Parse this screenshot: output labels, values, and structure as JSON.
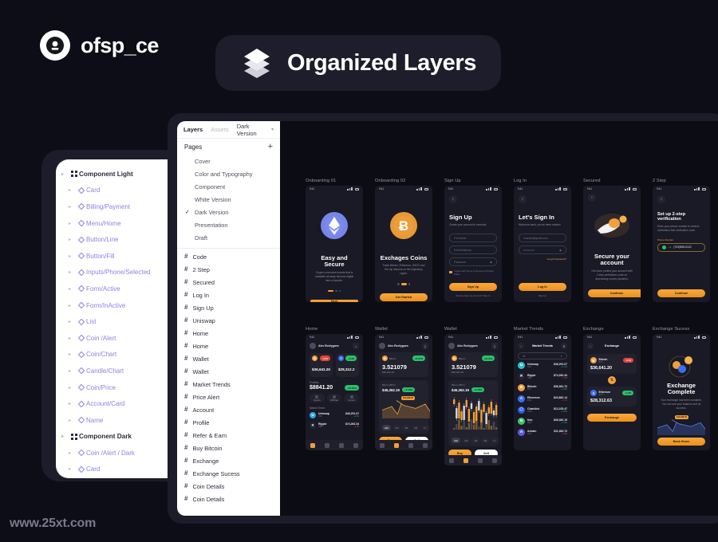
{
  "brand": {
    "name": "ofsp_ce",
    "logo_icon": "circle-avatar-icon"
  },
  "title_badge": {
    "text": "Organized Layers",
    "icon": "layers-icon"
  },
  "watermark": {
    "text": "www.25xt.com"
  },
  "colors": {
    "accent": "#F2A03A",
    "panel_dark": "#191a26",
    "page_bg": "#0d0d18",
    "green": "#2bbf6b",
    "red": "#e2453c",
    "purple_layer": "#8b84e0"
  },
  "light_panel": {
    "groups": [
      {
        "label": "Component Light",
        "icon": "component-icon",
        "items": [
          "Card",
          "Billing/Payment",
          "Menu/Home",
          "Button/Line",
          "Button/Fill",
          "Inputs/Phone/Selected",
          "Form/Active",
          "Form/InActive",
          "List",
          "Coin /Alert",
          "Coin/Chart",
          "Candle/Chart",
          "Coin/Price",
          "Account/Card",
          "Name"
        ]
      },
      {
        "label": "Component Dark",
        "icon": "component-icon",
        "items": [
          "Coin /Alert / Dark",
          "Card",
          "Card"
        ]
      }
    ]
  },
  "figma": {
    "tabs": [
      {
        "label": "Layers",
        "active": true
      },
      {
        "label": "Assets",
        "active": false
      }
    ],
    "version_selector": {
      "label": "Dark Version",
      "chevron": "chevron-down-icon"
    },
    "pages_header": {
      "label": "Pages",
      "add_icon": "plus-icon"
    },
    "pages": [
      {
        "name": "Cover",
        "selected": false
      },
      {
        "name": "Color and Typography",
        "selected": false
      },
      {
        "name": "Component",
        "selected": false
      },
      {
        "name": "White Version",
        "selected": false
      },
      {
        "name": "Dark Version",
        "selected": true
      },
      {
        "name": "Presentation",
        "selected": false
      },
      {
        "name": "Draft",
        "selected": false
      }
    ],
    "layers": [
      "Code",
      "2 Step",
      "Secured",
      "Log In",
      "Sign Up",
      "Uniswap",
      "Home",
      "Home",
      "Wallet",
      "Wallet",
      "Market Trends",
      "Price Alert",
      "Account",
      "Profile",
      "Refer & Earn",
      "Buy Bitcoin",
      "Exchange",
      "Exchange Sucess",
      "Coin Details",
      "Coin Details"
    ]
  },
  "canvas": {
    "frames_row1": [
      {
        "label": "Onboarding 01",
        "type": "onboarding",
        "status_time": "9:41",
        "title": "Easy and Secure",
        "subtitle": "Crypto currencies boards that is available all away become digital item a favorite.",
        "cta": "Next",
        "art_icon": "ethereum-coin-icon",
        "art_color": "#7b8cf0",
        "dots": 3,
        "active_dot": 0
      },
      {
        "label": "Onboarding 02",
        "type": "onboarding",
        "status_time": "9:41",
        "title": "Exchages Coins",
        "subtitle": "Trade Bitcoin, Ethereum, USDC and the top altcoins on the legendary crypto.",
        "cta": "Get Started",
        "art_icon": "bitcoin-coin-icon",
        "art_color": "#F2A03A",
        "dots": 3,
        "active_dot": 1
      },
      {
        "label": "Sign Up",
        "type": "form",
        "status_time": "9:41",
        "title": "Sign Up",
        "subtitle": "Create your account in seconds",
        "fields": [
          {
            "placeholder": "Full Name",
            "value": "",
            "icon": ""
          },
          {
            "placeholder": "Email Address",
            "value": "",
            "icon": ""
          },
          {
            "placeholder": "Password",
            "value": "",
            "icon": "eye-off-icon"
          }
        ],
        "checkbox_label": "I agree with Terms of Services & Privacy Policy",
        "cta": "Sign Up",
        "footer": "Already have an account? Sign In"
      },
      {
        "label": "Log In",
        "type": "form",
        "status_time": "9:41",
        "title": "Let's Sign In",
        "subtitle": "Welcome back, you've been missed",
        "fields": [
          {
            "placeholder": "Email Address",
            "value": "nhansol@gmail.com",
            "icon": ""
          },
          {
            "placeholder": "Password",
            "value": "••••••••••••",
            "icon": "eye-off-icon"
          }
        ],
        "link": "Forgot Password?",
        "cta": "Log In",
        "footer": "Sign Up"
      },
      {
        "label": "Secured",
        "type": "illustration",
        "status_time": "9:41",
        "title": "Secure your account",
        "subtitle": "Get more protect your account with 2 step verification code on decreasing money transfers.",
        "cta": "Continue",
        "art_icon": "rocket-icon"
      },
      {
        "label": "2 Step",
        "type": "verification",
        "status_time": "9:41",
        "title": "Set up 2-step verification",
        "subtitle": "Enter your phone number to receive verification that verification code.",
        "field_label": "Phone Number",
        "field_value": "(702)555-0122",
        "country_code": "+1",
        "cta": "Continue"
      }
    ],
    "frames_row2": [
      {
        "label": "Home",
        "type": "home",
        "status_time": "9:41",
        "user": "Alex Rodrygues",
        "bell_icon": "bell-icon",
        "cards": [
          {
            "coin": "Bitcoin",
            "sym": "BTC",
            "change": "-3.40",
            "change_dir": "down",
            "value": "$36,641.20",
            "color": "#F2A03A"
          },
          {
            "coin": "Ethereum",
            "sym": "ETH",
            "change": "+1.25",
            "change_dir": "up",
            "value": "$28,312.2",
            "color": "#3b6ef0"
          }
        ],
        "portfolio_label": "Portfolio",
        "portfolio_value": "$8841.20",
        "portfolio_change": "+12.05%",
        "actions": [
          "Deposit",
          "Withdraw",
          "Convert"
        ],
        "market_label": "Market Trend",
        "market": [
          {
            "name": "Uniswap",
            "sym": "UNI",
            "value": "$46,291.07",
            "change": "+4.10",
            "color": "#2aa6e8"
          },
          {
            "name": "Ripple",
            "sym": "XRP",
            "value": "$74,262.34",
            "change": "-1.40",
            "color": "#22232f"
          }
        ]
      },
      {
        "label": "Wallet",
        "type": "wallet_line",
        "status_time": "9:41",
        "user": "Alex Rodrygues",
        "balance": "3.521079",
        "balance_fiat": "$36,641.20",
        "badge": "+6.17%",
        "chart_title": "Bitcoin (BTC)",
        "chart_value": "$45,362.19",
        "chart_badge": "+2.18%",
        "tooltip": "$42,288.00",
        "ranges": [
          "24H",
          "1W",
          "1M",
          "3M",
          "1Y"
        ],
        "active_range": "24H",
        "buttons": [
          "Buy",
          "Sell"
        ]
      },
      {
        "label": "Wallet",
        "type": "wallet_candle",
        "status_time": "9:41",
        "user": "Alex Rodrygues",
        "balance": "3.521079",
        "balance_fiat": "$36,641.20",
        "badge": "+6.17%",
        "chart_title": "Bitcoin (BTC)",
        "chart_value": "$45,362.19",
        "chart_badge": "+2.18%",
        "ranges": [
          "24H",
          "1W",
          "1M",
          "3M",
          "1Y"
        ],
        "active_range": "24H",
        "buttons": [
          "Buy",
          "Sell"
        ]
      },
      {
        "label": "Market Trends",
        "type": "market",
        "status_time": "9:41",
        "header": "Market Trends",
        "search_placeholder": "All",
        "rows": [
          {
            "name": "Uniswap",
            "sym": "UNI",
            "value": "$46,291.07",
            "change": "+ 1.7%",
            "dir": "up",
            "color": "#2ac3c9"
          },
          {
            "name": "Ripple",
            "sym": "XRP",
            "value": "$74,262.34",
            "change": "- 1.4%",
            "dir": "down",
            "color": "#22232f"
          },
          {
            "name": "Bitcoin",
            "sym": "BTC",
            "value": "$36,361.72",
            "change": "+ 2.4%",
            "dir": "up",
            "color": "#F2A03A"
          },
          {
            "name": "Ethereum",
            "sym": "ETH",
            "value": "$24,862.14",
            "change": "- 1.1%",
            "dir": "down",
            "color": "#3b6ef0"
          },
          {
            "name": "Chainlink",
            "sym": "LINK",
            "value": "$12,225.47",
            "change": "+ 0.9%",
            "dir": "up",
            "color": "#2c5ce0"
          },
          {
            "name": "Neo",
            "sym": "NEO",
            "value": "$36,382.19",
            "change": "+ 1.9%",
            "dir": "up",
            "color": "#3ec46a"
          },
          {
            "name": "Achain",
            "sym": "ACT",
            "value": "$11,362.72",
            "change": "- 1.8%",
            "dir": "down",
            "color": "#5b5ce0"
          }
        ]
      },
      {
        "label": "Exchange",
        "type": "exchange",
        "status_time": "9:41",
        "header": "Exchange",
        "from": {
          "coin": "Bitcoin",
          "sym": "BTC",
          "amount": "$36,641.20",
          "badge": "-3.40",
          "dir": "down",
          "color": "#F2A03A"
        },
        "to": {
          "coin": "Ethereum",
          "sym": "ETH",
          "amount": "$28,312.63",
          "badge": "+1.25",
          "dir": "up",
          "color": "#3b6ef0"
        },
        "swap_icon": "swap-icon",
        "cta": "Exchange"
      },
      {
        "label": "Exchange Sucess",
        "type": "success",
        "status_time": "9:41",
        "title": "Exchange Complete",
        "subtitle": "Your exchange has been complete, You can see your balance and its success.",
        "tooltip": "$42,288.00",
        "cta": "Back Home"
      }
    ]
  }
}
